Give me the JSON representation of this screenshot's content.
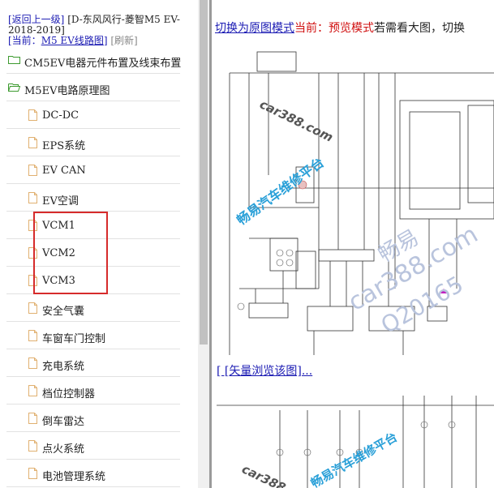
{
  "header": {
    "back_label": "[返回上一级]",
    "breadcrumb": "[D-东风风行-菱智M5 EV-2018-2019]",
    "current_prefix": "[当前：",
    "current_value": "M5 EV线路图",
    "current_suffix": "]",
    "refresh_label": "[刷新]"
  },
  "tree": {
    "folders": [
      {
        "label": "CM5EV电器元件布置及线束布置",
        "state": "closed"
      },
      {
        "label": "M5EV电路原理图",
        "state": "open"
      }
    ],
    "files": [
      "DC-DC",
      "EPS系统",
      "EV CAN",
      "EV空调",
      "VCM1",
      "VCM2",
      "VCM3",
      "安全气囊",
      "车窗车门控制",
      "充电系统",
      "档位控制器",
      "倒车雷达",
      "点火系统",
      "电池管理系统"
    ]
  },
  "viewer": {
    "switch_link": "切换为原图模式",
    "current_label": "当前：",
    "mode_label": "预览模式",
    "hint": "若需看大图，切换",
    "vector_link": "[ [矢量浏览该图]...",
    "watermark_site": "car388.com",
    "watermark_brand": "畅易汽车维修平台",
    "watermark_big": "畅易",
    "watermark_big2": "car388.com",
    "watermark_num": "Q20165"
  },
  "colors": {
    "link": "#1b1bb3",
    "accent_red": "#d01010",
    "highlight_box": "#d62b2b",
    "folder": "#3c9a2e"
  }
}
